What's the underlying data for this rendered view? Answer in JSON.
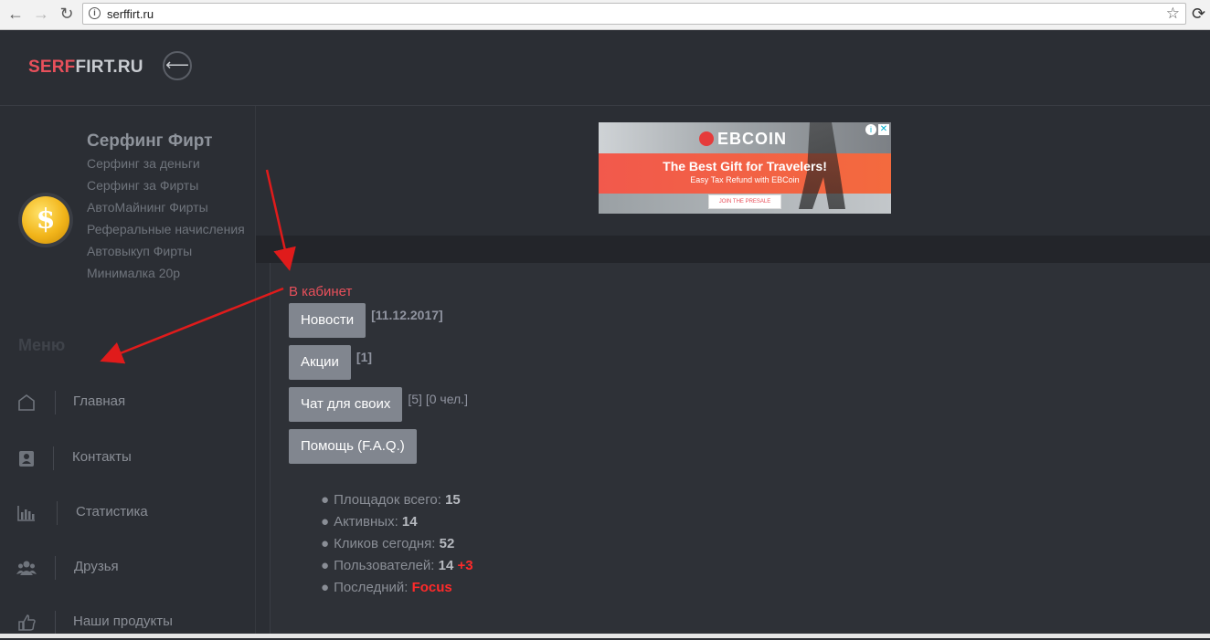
{
  "browser": {
    "url": "serffirt.ru",
    "back_icon": "arrow-left-icon",
    "forward_icon": "arrow-right-icon",
    "reload_icon": "reload-icon"
  },
  "header": {
    "logo_part1": "SERF",
    "logo_part2": "FIRT.RU",
    "logo_colors": {
      "part1": "#e8505b",
      "part2": "#c9ccd1"
    },
    "toggle_icon": "arrow-left-icon"
  },
  "sidebar": {
    "profile_title": "Серфинг Фирт",
    "profile_links": [
      "Серфинг за деньги",
      "Серфинг за Фирты",
      "АвтоМайнинг Фирты",
      "Реферальные начисления",
      "Автовыкуп Фирты",
      "Минималка 20р"
    ],
    "menu_heading": "Меню",
    "menu_items": [
      {
        "label": "Главная",
        "icon": "home-icon"
      },
      {
        "label": "Контакты",
        "icon": "contacts-icon"
      },
      {
        "label": "Статистика",
        "icon": "bar-chart-icon"
      },
      {
        "label": "Друзья",
        "icon": "users-icon"
      },
      {
        "label": "Наши продукты",
        "icon": "thumbs-up-icon"
      }
    ]
  },
  "ad": {
    "brand": "EBCOIN",
    "headline": "The Best Gift for Travelers!",
    "sub": "Easy Tax Refund with EBCoin",
    "cta": "JOIN THE PRESALE"
  },
  "main": {
    "cabinet_link": "В кабинет",
    "buttons": [
      {
        "label": "Новости",
        "note": "[11.12.2017]"
      },
      {
        "label": "Акции",
        "note": "[1]"
      },
      {
        "label": "Чат для своих",
        "note": "[5] [0 чел.]"
      },
      {
        "label": "Помощь (F.A.Q.)",
        "note": ""
      }
    ],
    "stats": [
      {
        "label": "Площадок всего:",
        "value": "15",
        "extra": ""
      },
      {
        "label": "Активных:",
        "value": "14",
        "extra": ""
      },
      {
        "label": "Кликов сегодня:",
        "value": "52",
        "extra": ""
      },
      {
        "label": "Пользователей:",
        "value": "14",
        "extra": "+3"
      },
      {
        "label": "Последний:",
        "value": "",
        "extra": "Focus"
      }
    ]
  },
  "colors": {
    "background": "#2b2e34",
    "accent_red": "#e8505b",
    "button": "#81868f",
    "annotation_arrow": "#e01b1b"
  }
}
